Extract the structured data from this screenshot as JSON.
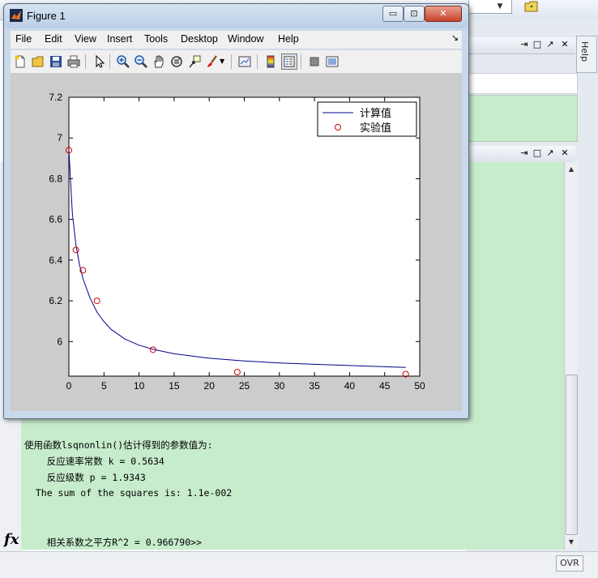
{
  "figure": {
    "title": "Figure 1",
    "window_buttons": {
      "minimize": "▭",
      "restore": "⊡",
      "close": "✕"
    },
    "menus": [
      "File",
      "Edit",
      "View",
      "Insert",
      "Tools",
      "Desktop",
      "Window",
      "Help"
    ],
    "toolbar_icons": [
      "new-figure-icon",
      "open-icon",
      "save-icon",
      "print-icon",
      "pointer-icon",
      "zoom-in-icon",
      "zoom-out-icon",
      "pan-icon",
      "rotate-icon",
      "data-cursor-icon",
      "brush-icon",
      "link-icon",
      "colorbar-icon",
      "legend-icon",
      "hide-tools-icon",
      "show-tools-icon"
    ]
  },
  "chart_data": {
    "type": "line",
    "xlim": [
      0,
      50
    ],
    "ylim": [
      5.83,
      7.2
    ],
    "xticks": [
      0,
      5,
      10,
      15,
      20,
      25,
      30,
      35,
      40,
      45,
      50
    ],
    "yticks": [
      6,
      6.2,
      6.4,
      6.6,
      6.8,
      7,
      7.2
    ],
    "ytick_labels": [
      "6",
      "6.2",
      "6.4",
      "6.6",
      "6.8",
      "7",
      "7.2"
    ],
    "legend_position": "top-right",
    "series": [
      {
        "name": "计算值",
        "style": "line",
        "color": "#00008b",
        "x": [
          0,
          0.5,
          1,
          1.5,
          2,
          3,
          4,
          5,
          6,
          8,
          10,
          12,
          15,
          20,
          25,
          30,
          35,
          40,
          45,
          48
        ],
        "y": [
          6.94,
          6.63,
          6.475,
          6.38,
          6.31,
          6.215,
          6.145,
          6.098,
          6.06,
          6.012,
          5.982,
          5.962,
          5.94,
          5.918,
          5.905,
          5.895,
          5.888,
          5.882,
          5.876,
          5.873
        ]
      },
      {
        "name": "实验值",
        "style": "markers",
        "marker": "circle",
        "color": "#cc0000",
        "x": [
          0,
          1,
          2,
          4,
          12,
          24,
          48
        ],
        "y": [
          6.94,
          6.45,
          6.35,
          6.2,
          5.96,
          5.85,
          5.84
        ]
      }
    ]
  },
  "command_window": {
    "lines": [
      "使用函数lsqnonlin()估计得到的参数值为:",
      "    反应速率常数 k = 0.5634",
      "    反应级数 p = 1.9343",
      "  The sum of the squares is: 1.1e-002",
      "    相关系数之平方R^2 = 0.966790>>"
    ],
    "prompt_icon": "fx"
  },
  "desktop": {
    "help_tab": "Help",
    "status_ovr": "OVR"
  }
}
